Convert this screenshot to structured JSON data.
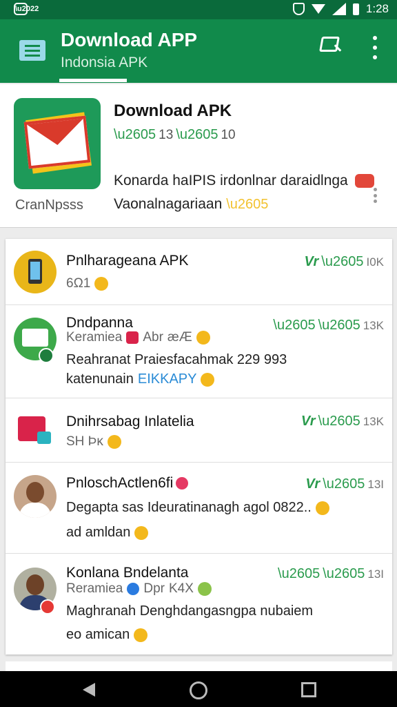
{
  "status_bar": {
    "time": "1:28"
  },
  "app_bar": {
    "title": "Download APP",
    "subtitle": "Indonsia APK"
  },
  "featured": {
    "title": "Download APK",
    "rating_a": "13",
    "rating_b": "10",
    "caption": "CranNpsss",
    "desc_line1": "Konarda haIPIS irdonlnar daraidlnga",
    "desc_line2": "Vaonalnagariaan"
  },
  "list": [
    {
      "name": "Pnlharageana APK",
      "meta": "6Ω1",
      "rating": "I0K",
      "prefix": "Vr"
    },
    {
      "name": "Dndpanna",
      "meta": "Keramiea",
      "meta2": "Abr",
      "meta3": "æÆ",
      "line1": "Reahranat Praiesfacahmak 229 993",
      "line2_a": "katenunain",
      "line2_link": "EIKKAPY",
      "rating": "13K"
    },
    {
      "name": "Dnihrsabag Inlatelia",
      "meta": "SH Þĸ",
      "rating": "13K",
      "prefix": "Vr"
    },
    {
      "name": "PnloschActlen6fi",
      "line1": "Degapta sas Ideuratinanagh agol 0822..",
      "line2_a": "ad amldan",
      "rating": "13I",
      "prefix": "Vr"
    },
    {
      "name": "Konlana Bndelanta",
      "meta": "Reramiea",
      "meta2": "Dpr",
      "meta3": "K4X",
      "line1": "Maghranah Denghdangasngpa nubaiem",
      "line2_a": "eo amican",
      "rating": "13I"
    }
  ]
}
